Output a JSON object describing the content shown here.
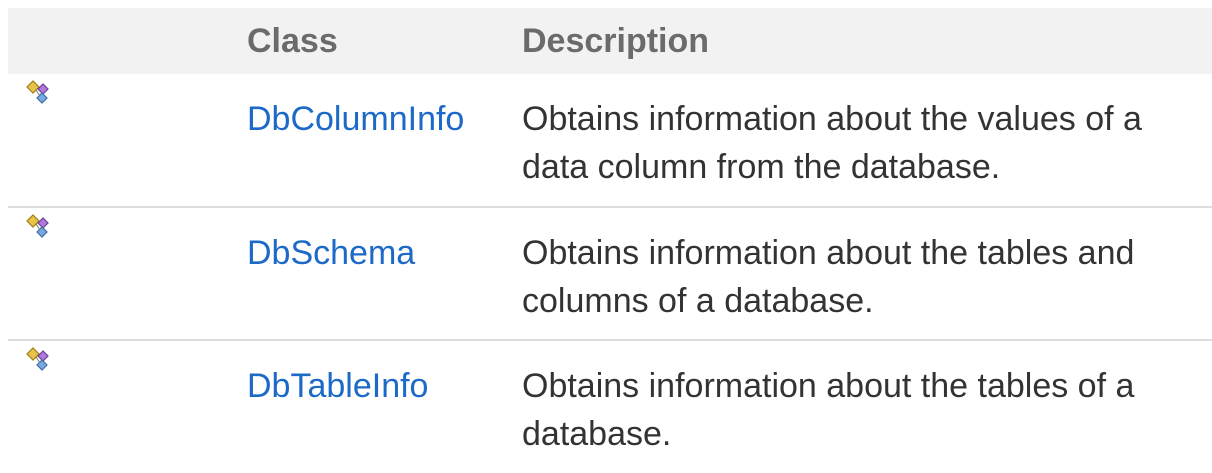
{
  "table": {
    "headers": {
      "icon": "",
      "class": "Class",
      "description": "Description"
    },
    "rows": [
      {
        "icon": "public-class-icon",
        "name": "DbColumnInfo",
        "description": "Obtains information about the values of a data column from the database."
      },
      {
        "icon": "public-class-icon",
        "name": "DbSchema",
        "description": "Obtains information about the tables and columns of a database."
      },
      {
        "icon": "public-class-icon",
        "name": "DbTableInfo",
        "description": "Obtains information about the tables of a database."
      }
    ]
  },
  "colors": {
    "header_bg": "#f2f2f2",
    "header_text": "#6b6b6b",
    "link": "#1c69c7",
    "body_text": "#333333",
    "row_divider": "#dddddd"
  }
}
